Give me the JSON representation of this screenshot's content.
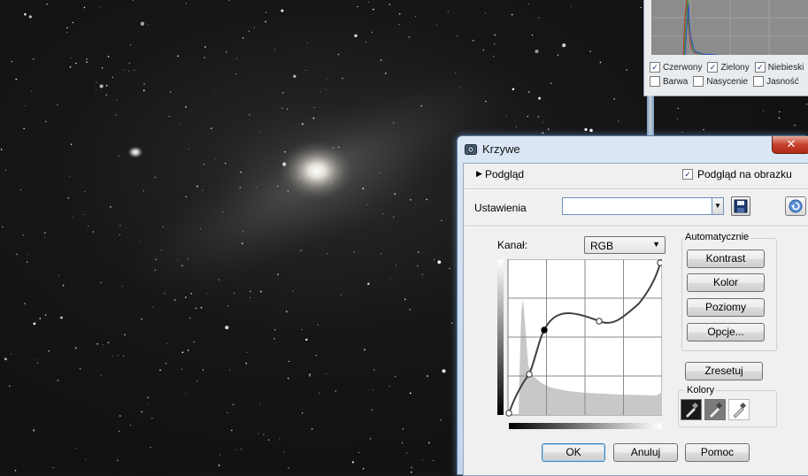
{
  "histogram_panel": {
    "checkboxes_row1": [
      {
        "label": "Czerwony",
        "checked": true
      },
      {
        "label": "Zielony",
        "checked": true
      },
      {
        "label": "Niebieski",
        "checked": true
      }
    ],
    "checkboxes_row2": [
      {
        "label": "Barwa",
        "checked": false
      },
      {
        "label": "Nasycenie",
        "checked": false
      },
      {
        "label": "Jasność",
        "checked": false
      }
    ]
  },
  "dialog": {
    "title": "Krzywe",
    "close_glyph": "✕",
    "preview_label": "Podgląd",
    "preview_on_image_label": "Podgląd na obrazku",
    "preview_on_image_checked": true,
    "settings_label": "Ustawienia",
    "settings_value": "",
    "channel_label": "Kanał:",
    "channel_value": "RGB",
    "auto_group_label": "Automatycznie",
    "btn_contrast": "Kontrast",
    "btn_color": "Kolor",
    "btn_levels": "Poziomy",
    "btn_options": "Opcje...",
    "btn_reset": "Zresetuj",
    "colors_group_label": "Kolory",
    "btn_ok": "OK",
    "btn_cancel": "Anuluj",
    "btn_help": "Pomoc"
  },
  "colors": {
    "title_bar": "#c2d6ee",
    "close_red": "#c4412c",
    "accent_blue": "#3c7fb1"
  },
  "icons": {
    "title": "curves-app-icon",
    "expand": "triangle-right-icon",
    "save": "floppy-disk-icon",
    "reset": "circular-arrow-icon",
    "dropdown": "chevron-down-icon",
    "eyedroppers": [
      "black-point-eyedropper-icon",
      "gray-point-eyedropper-icon",
      "white-point-eyedropper-icon"
    ]
  }
}
